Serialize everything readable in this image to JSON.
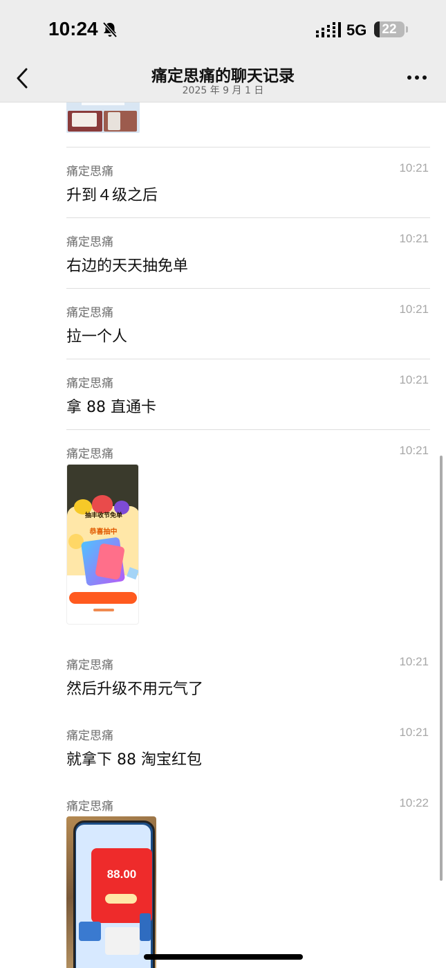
{
  "status_bar": {
    "time": "10:24",
    "network": "5G",
    "battery": "22",
    "icons": [
      "bell-muted-icon",
      "signal-icon"
    ]
  },
  "header": {
    "title": "痛定思痛的聊天记录",
    "subtitle": "2025 年 9 月 1 日",
    "back_icon": "chevron-left-icon",
    "more_icon": "more-dots-icon"
  },
  "messages": [
    {
      "sender": "痛定思痛",
      "time": "10:21",
      "text": "升到４级之后"
    },
    {
      "sender": "痛定思痛",
      "time": "10:21",
      "text": "右边的天天抽免单"
    },
    {
      "sender": "痛定思痛",
      "time": "10:21",
      "text": "拉一个人"
    },
    {
      "sender": "痛定思痛",
      "time": "10:21",
      "text": "拿 88 直通卡"
    },
    {
      "sender": "痛定思痛",
      "time": "10:21",
      "image": "promo-screenshot"
    },
    {
      "sender": "痛定思痛",
      "time": "10:21",
      "text": "然后升级不用元气了"
    },
    {
      "sender": "痛定思痛",
      "time": "10:21",
      "text": "就拿下 88 淘宝红包"
    },
    {
      "sender": "痛定思痛",
      "time": "10:22",
      "image": "red-packet-photo"
    }
  ],
  "images": {
    "promo_title": "抽丰收节免单",
    "promo_won": "恭喜抽中",
    "red_packet_amount": "88.00"
  },
  "colors": {
    "header_bg": "#ededed",
    "sender": "#6f6f6f",
    "time": "#a7a7a7",
    "divider": "#dedede",
    "promo_button": "#ff5a1f",
    "red_packet": "#ee2b2b"
  }
}
